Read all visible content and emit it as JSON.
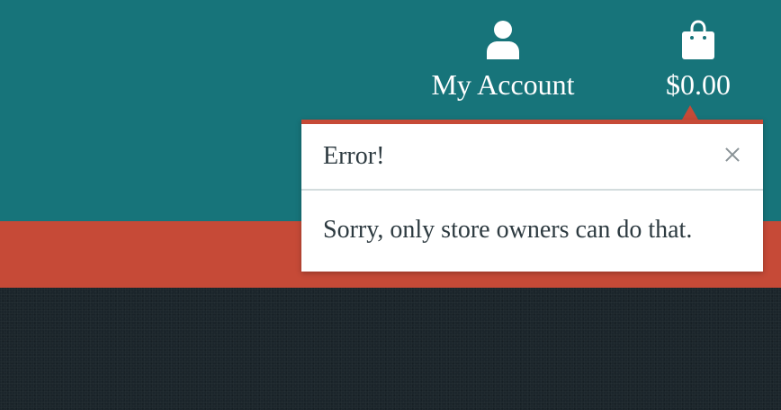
{
  "header": {
    "account": {
      "icon": "user-icon",
      "label": "My Account"
    },
    "cart": {
      "icon": "shopping-bag-icon",
      "label": "$0.00"
    }
  },
  "popup": {
    "title": "Error!",
    "message": "Sorry, only store owners can do that.",
    "close_icon": "close-icon"
  },
  "colors": {
    "header_bg": "#17747a",
    "accent_red": "#c64a37",
    "dark_bg": "#1b252b",
    "text_dark": "#2d3a40"
  }
}
